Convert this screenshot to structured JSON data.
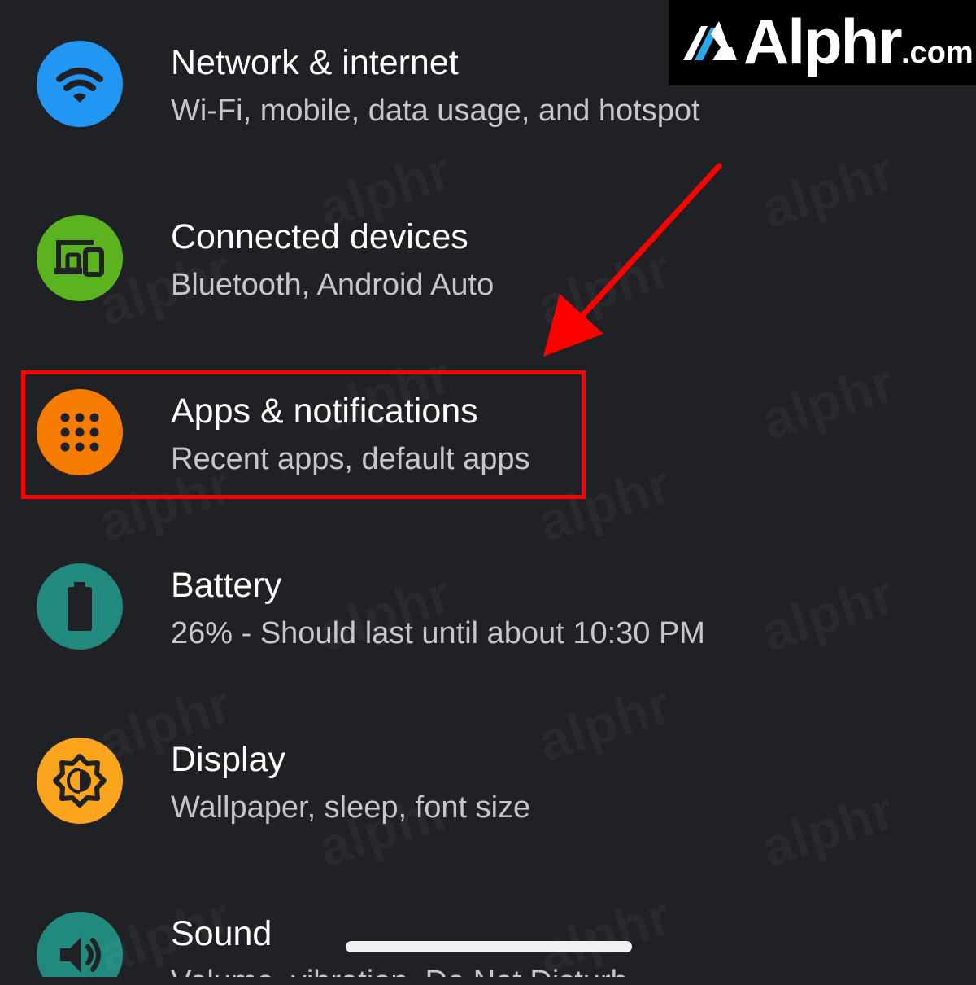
{
  "brand": {
    "wordmark": "Alphr",
    "suffix": ".com",
    "watermark": "alphr"
  },
  "settings": [
    {
      "title": "Network & internet",
      "subtitle": "Wi-Fi, mobile, data usage, and hotspot",
      "icon": "wifi-icon",
      "color": "#2196F3"
    },
    {
      "title": "Connected devices",
      "subtitle": "Bluetooth, Android Auto",
      "icon": "devices-icon",
      "color": "#5BB31F"
    },
    {
      "title": "Apps & notifications",
      "subtitle": "Recent apps, default apps",
      "icon": "apps-grid-icon",
      "color": "#F57C00"
    },
    {
      "title": "Battery",
      "subtitle": "26% - Should last until about 10:30 PM",
      "icon": "battery-icon",
      "color": "#21897E"
    },
    {
      "title": "Display",
      "subtitle": "Wallpaper, sleep, font size",
      "icon": "brightness-icon",
      "color": "#FBA51E"
    },
    {
      "title": "Sound",
      "subtitle": "Volume, vibration, Do Not Disturb",
      "icon": "volume-icon",
      "color": "#21897E"
    }
  ],
  "annotation": {
    "color": "#FF0000"
  }
}
